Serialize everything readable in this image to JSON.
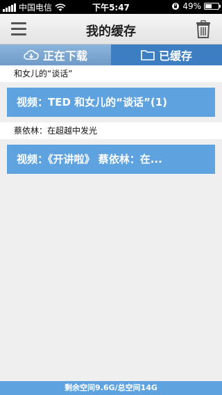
{
  "status_bar": {
    "carrier": "中国电信",
    "time": "下午5:47",
    "battery": "49%",
    "battery_level": 0.49
  },
  "nav": {
    "title": "我的缓存"
  },
  "tabs": [
    {
      "label": "正在下载",
      "icon": "cloud-download-icon"
    },
    {
      "label": "已缓存",
      "icon": "folder-icon",
      "active": true
    }
  ],
  "groups": [
    {
      "label": "和女儿的“谈话”",
      "item": "视频：TED 和女儿的“谈话”(1)"
    },
    {
      "label": "蔡依林：在超越中发光",
      "item": "视频：《开讲啦》 蔡依林：在..."
    }
  ],
  "storage": {
    "text": "剩余空间9.6G/总空间14G"
  }
}
